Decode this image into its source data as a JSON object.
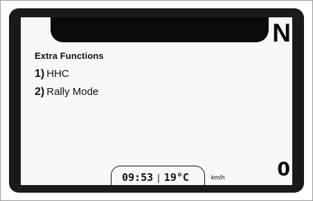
{
  "dashboard": {
    "gear": "N",
    "menu": {
      "title": "Extra Functions",
      "items": [
        {
          "number": "1)",
          "label": "HHC"
        },
        {
          "number": "2)",
          "label": "Rally Mode"
        }
      ]
    },
    "status": {
      "time": "09:53",
      "separator": "|",
      "temperature": "19°C"
    },
    "speed": {
      "value": "0",
      "unit": "km/h"
    }
  },
  "colors": {
    "bezel": "#1a1a1a",
    "screen": "#f7f7f7",
    "text": "#111111"
  }
}
